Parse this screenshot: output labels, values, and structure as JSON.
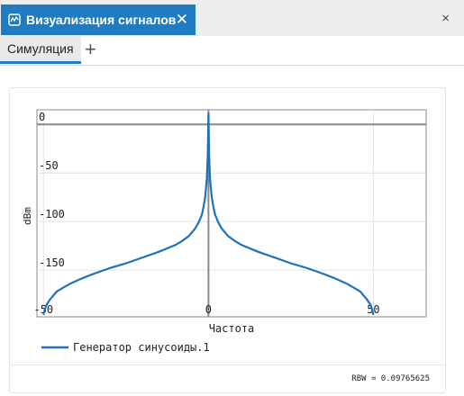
{
  "window": {
    "title": "Визуализация сигналов",
    "close_glyph": "✕",
    "window_close_glyph": "×"
  },
  "tabs": {
    "active_label": "Симуляция",
    "add_glyph": "+"
  },
  "colors": {
    "accent": "#1f7cc1",
    "trace": "#1f72b8"
  },
  "chart_data": {
    "type": "line",
    "xlabel": "Частота",
    "ylabel": "dBm",
    "xlim": [
      -52,
      66
    ],
    "ylim": [
      -198,
      15
    ],
    "xticks": [
      -50,
      0,
      50
    ],
    "yticks": [
      0,
      -50,
      -100,
      -150
    ],
    "grid": true,
    "legend_placement": "bottom-left",
    "series": [
      {
        "name": "Генератор синусоиды.1",
        "x": [
          -50,
          -49.6,
          -49,
          -48,
          -47,
          -46,
          -44,
          -42,
          -40,
          -38,
          -35,
          -30,
          -25,
          -20,
          -15,
          -10,
          -8,
          -6,
          -4,
          -3,
          -2,
          -1.5,
          -1,
          -0.5,
          -0.2,
          0,
          0.2,
          0.5,
          1,
          1.5,
          2,
          3,
          4,
          6,
          8,
          10,
          15,
          20,
          25,
          30,
          35,
          38,
          40,
          42,
          44,
          46,
          47,
          48,
          49,
          49.6,
          50
        ],
        "y": [
          -196,
          -190,
          -185,
          -180,
          -176,
          -172,
          -168,
          -164,
          -161,
          -158,
          -154,
          -148,
          -143,
          -137,
          -131,
          -124,
          -120,
          -115,
          -107,
          -101,
          -93,
          -85,
          -75,
          -57,
          -32,
          12,
          -32,
          -57,
          -75,
          -85,
          -93,
          -101,
          -107,
          -115,
          -120,
          -124,
          -131,
          -137,
          -143,
          -148,
          -154,
          -158,
          -161,
          -164,
          -168,
          -172,
          -176,
          -180,
          -185,
          -190,
          -196
        ]
      }
    ],
    "annotation": "RBW = 0.09765625"
  }
}
